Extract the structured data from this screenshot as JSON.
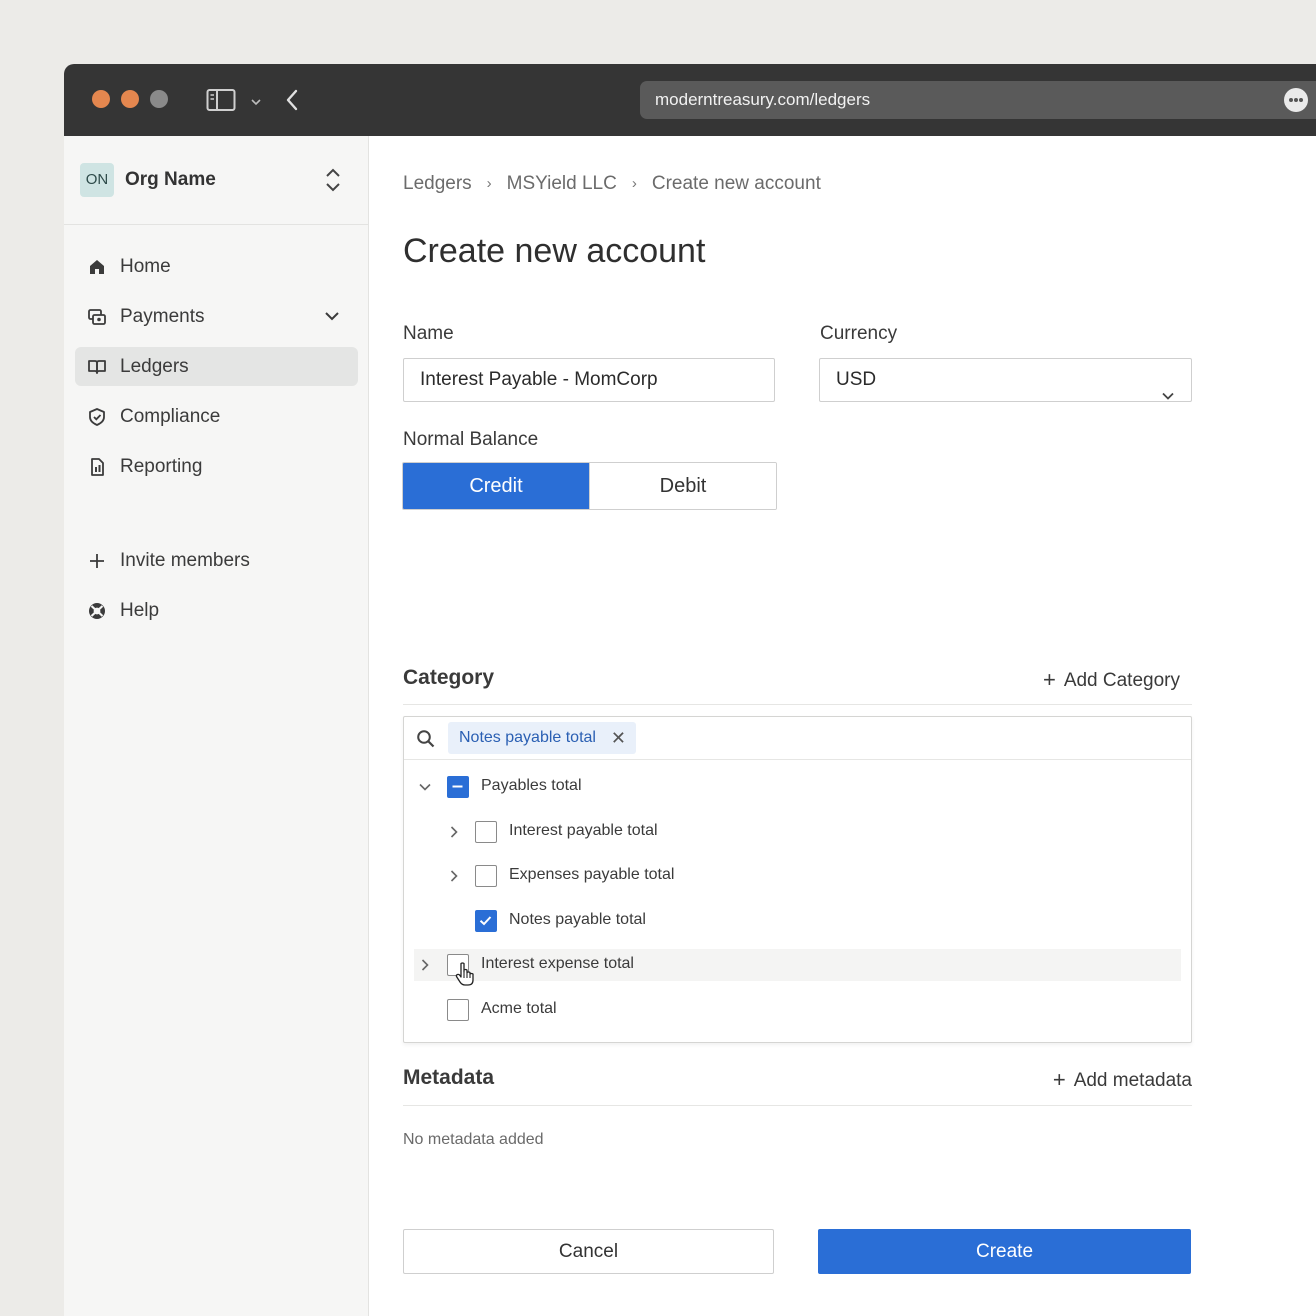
{
  "browser": {
    "url": "moderntreasury.com/ledgers"
  },
  "sidebar": {
    "org": {
      "initials": "ON",
      "name": "Org Name"
    },
    "items": [
      {
        "label": "Home",
        "icon": "home-icon"
      },
      {
        "label": "Payments",
        "icon": "payments-icon"
      },
      {
        "label": "Ledgers",
        "icon": "book-icon",
        "active": true
      },
      {
        "label": "Compliance",
        "icon": "shield-icon"
      },
      {
        "label": "Reporting",
        "icon": "report-icon"
      }
    ],
    "secondary": [
      {
        "label": "Invite members",
        "icon": "plus-icon"
      },
      {
        "label": "Help",
        "icon": "help-icon"
      }
    ]
  },
  "breadcrumb": [
    "Ledgers",
    "MSYield LLC",
    "Create new account"
  ],
  "page_title": "Create new account",
  "form": {
    "name_label": "Name",
    "name_value": "Interest Payable - MomCorp",
    "currency_label": "Currency",
    "currency_value": "USD",
    "normal_balance_label": "Normal Balance",
    "normal_balance_options": [
      "Credit",
      "Debit"
    ],
    "normal_balance_selected": "Credit"
  },
  "category": {
    "title": "Category",
    "add_label": "Add Category",
    "chip": "Notes payable total",
    "tree": [
      {
        "label": "Payables total",
        "state": "mixed",
        "expanded": true
      },
      {
        "label": "Interest payable total",
        "state": "unchecked"
      },
      {
        "label": "Expenses payable total",
        "state": "unchecked"
      },
      {
        "label": "Notes payable total",
        "state": "checked"
      },
      {
        "label": "Interest expense total",
        "state": "unchecked"
      },
      {
        "label": "Acme total",
        "state": "unchecked"
      }
    ]
  },
  "metadata": {
    "title": "Metadata",
    "add_label": "Add metadata",
    "empty_text": "No metadata added"
  },
  "actions": {
    "cancel": "Cancel",
    "create": "Create"
  },
  "colors": {
    "accent": "#2a6ed6",
    "titlebar": "#353535",
    "traffic_close": "#e4874f",
    "traffic_min": "#e4874f",
    "traffic_max": "#8a8a8a"
  }
}
